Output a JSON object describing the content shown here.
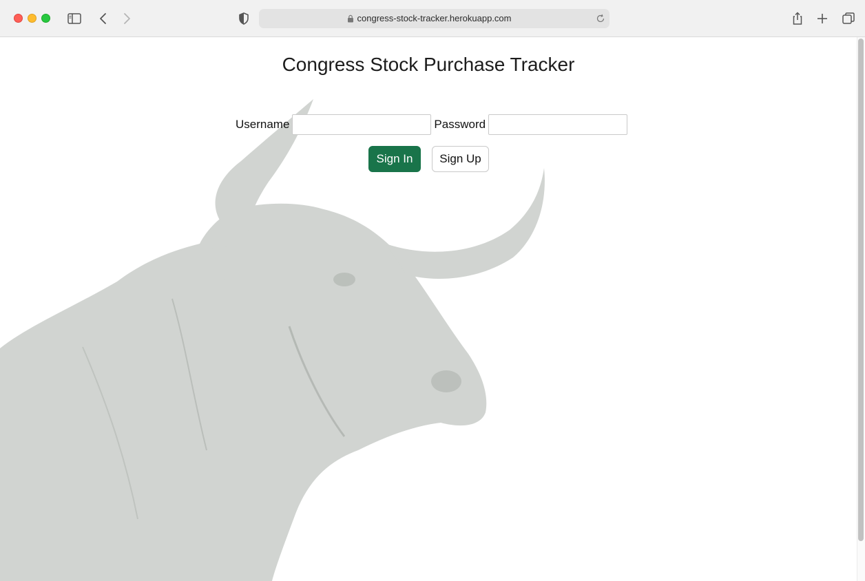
{
  "browser": {
    "url": "congress-stock-tracker.herokuapp.com"
  },
  "page": {
    "title": "Congress Stock Purchase Tracker",
    "form": {
      "username_label": "Username",
      "username_value": "",
      "password_label": "Password",
      "password_value": "",
      "sign_in_label": "Sign In",
      "sign_up_label": "Sign Up"
    }
  },
  "colors": {
    "primary_button": "#19744a",
    "background": "#ffffff",
    "bull_tint": "#c9cdc9"
  },
  "icons": [
    "sidebar-icon",
    "back-icon",
    "forward-icon",
    "shield-icon",
    "lock-icon",
    "reload-icon",
    "share-icon",
    "new-tab-icon",
    "tabs-overview-icon"
  ]
}
